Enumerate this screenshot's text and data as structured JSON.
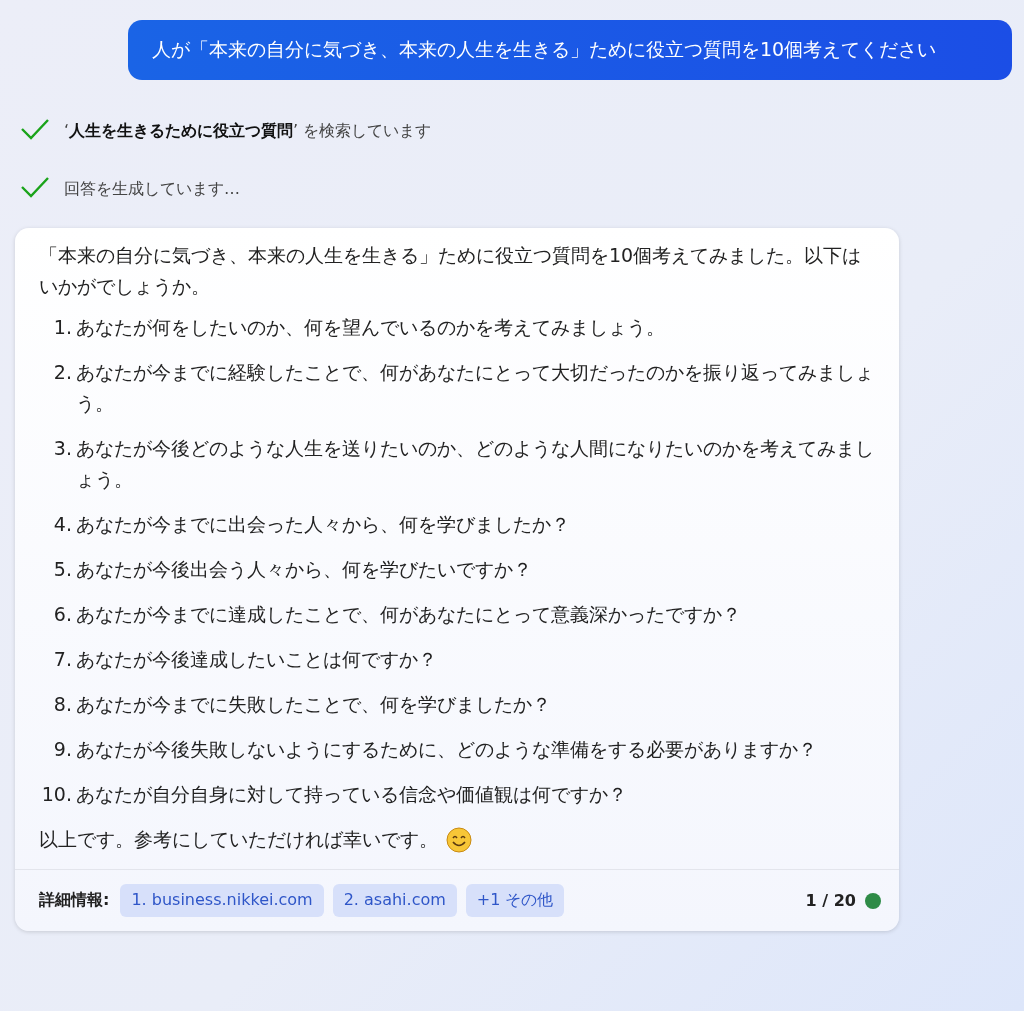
{
  "user_message": "人が「本来の自分に気づき、本来の人生を生きる」ために役立つ質問を10個考えてください",
  "steps": [
    {
      "text": "‘**人生を生きるために役立つ質問**’ を検索しています",
      "done": true
    },
    {
      "text": "回答を生成しています…",
      "done": true
    }
  ],
  "answer": {
    "intro": "「本来の自分に気づき、本来の人生を生きる」ために役立つ質問を10個考えてみました。以下はいかがでしょうか。",
    "items": [
      {
        "number": "1.",
        "text": "あなたが何をしたいのか、何を望んでいるのかを考えてみましょう。"
      },
      {
        "number": "2.",
        "text": "あなたが今までに経験したことで、何があなたにとって大切だったのかを振り返ってみましょう。"
      },
      {
        "number": "3.",
        "text": "あなたが今後どのような人生を送りたいのか、どのような人間になりたいのかを考えてみましょう。"
      },
      {
        "number": "4.",
        "text": "あなたが今までに出会った人々から、何を学びましたか？"
      },
      {
        "number": "5.",
        "text": "あなたが今後出会う人々から、何を学びたいですか？"
      },
      {
        "number": "6.",
        "text": "あなたが今までに達成したことで、何があなたにとって意義深かったですか？"
      },
      {
        "number": "7.",
        "text": "あなたが今後達成したいことは何ですか？"
      },
      {
        "number": "8.",
        "text": "あなたが今までに失敗したことで、何を学びましたか？"
      },
      {
        "number": "9.",
        "text": "あなたが今後失敗しないようにするために、どのような準備をする必要がありますか？"
      },
      {
        "number": "10.",
        "text": "あなたが自分自身に対して持っている信念や価値観は何ですか？"
      }
    ],
    "closing": "以上です。参考にしていただければ幸いです。",
    "footer": {
      "label": "詳細情報:",
      "links": [
        "1. business.nikkei.com",
        "2. asahi.com",
        "+1 その他"
      ],
      "count": "1 / 20"
    }
  }
}
